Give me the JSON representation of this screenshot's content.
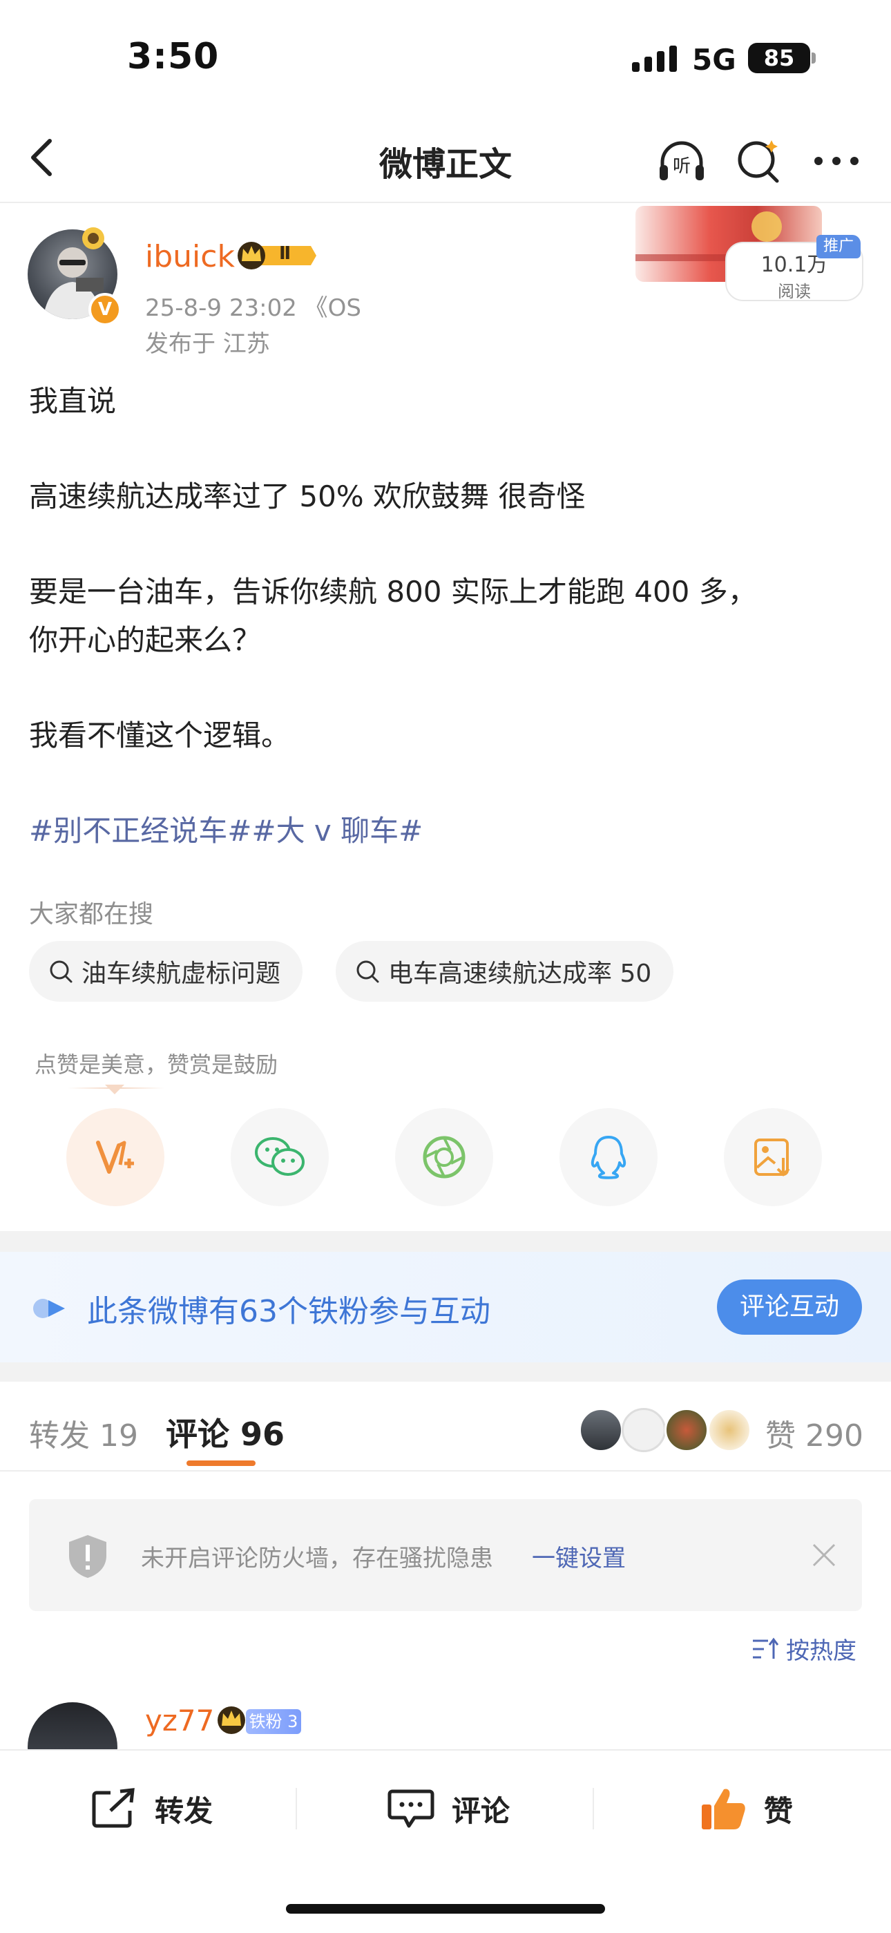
{
  "status_bar": {
    "time": "3:50",
    "network": "5G",
    "battery": "85"
  },
  "nav": {
    "title": "微博正文"
  },
  "post": {
    "username": "ibuick",
    "time_device": "25-8-9 23:02 《OS",
    "location": "发布于 江苏",
    "read_count": "10.1万",
    "read_label": "阅读",
    "promo_label": "推广",
    "vip_badge": "Ⅱ",
    "lines": [
      "我直说",
      "高速续航达成率过了 50% 欢欣鼓舞 很奇怪",
      "要是一台油车，告诉你续航 800 实际上才能跑 400 多，",
      "你开心的起来么？",
      "我看不懂这个逻辑。"
    ],
    "hashtags": "#别不正经说车##大 v 聊车#"
  },
  "search": {
    "label": "大家都在搜",
    "chips": [
      "油车续航虚标问题",
      "电车高速续航达成率 50"
    ]
  },
  "reward": {
    "hint": "点赞是美意，赞赏是鼓励"
  },
  "share_icons": [
    "reward-v-icon",
    "wechat-icon",
    "moments-icon",
    "qq-icon",
    "save-image-icon"
  ],
  "fans": {
    "text": "此条微博有63个铁粉参与互动",
    "button": "评论互动"
  },
  "tabs": {
    "repost": "转发 19",
    "comment": "评论 96",
    "likes": "赞 290"
  },
  "firewall": {
    "text": "未开启评论防火墙，存在骚扰隐患",
    "link": "一键设置"
  },
  "sort": {
    "label": "按热度"
  },
  "comment": {
    "username": "yz77",
    "badge": "铁粉 3"
  },
  "bottom_bar": {
    "repost": "转发",
    "comment": "评论",
    "like": "赞"
  },
  "colors": {
    "accent_orange": "#ee6a22",
    "link_blue": "#4e67b5",
    "hashtag": "#5868a3",
    "fans_blue": "#3e76d6"
  }
}
